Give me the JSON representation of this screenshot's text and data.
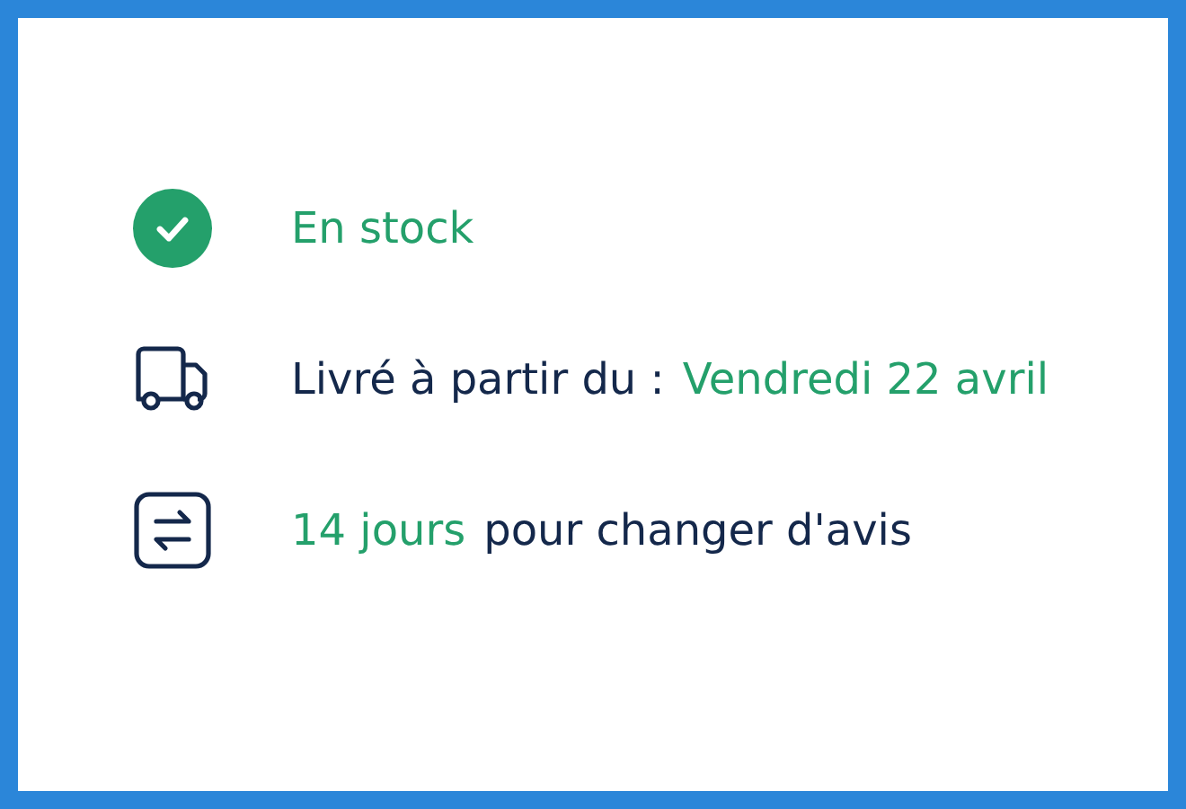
{
  "rows": [
    {
      "kind": "check",
      "segments": [
        {
          "text": "En stock",
          "accent": true
        }
      ]
    },
    {
      "kind": "truck",
      "segments": [
        {
          "text": "Livré à partir du :",
          "accent": false
        },
        {
          "text": "Vendredi 22 avril",
          "accent": true
        }
      ]
    },
    {
      "kind": "exchange",
      "segments": [
        {
          "text": "14 jours",
          "accent": true
        },
        {
          "text": "pour changer d'avis",
          "accent": false
        }
      ]
    }
  ]
}
